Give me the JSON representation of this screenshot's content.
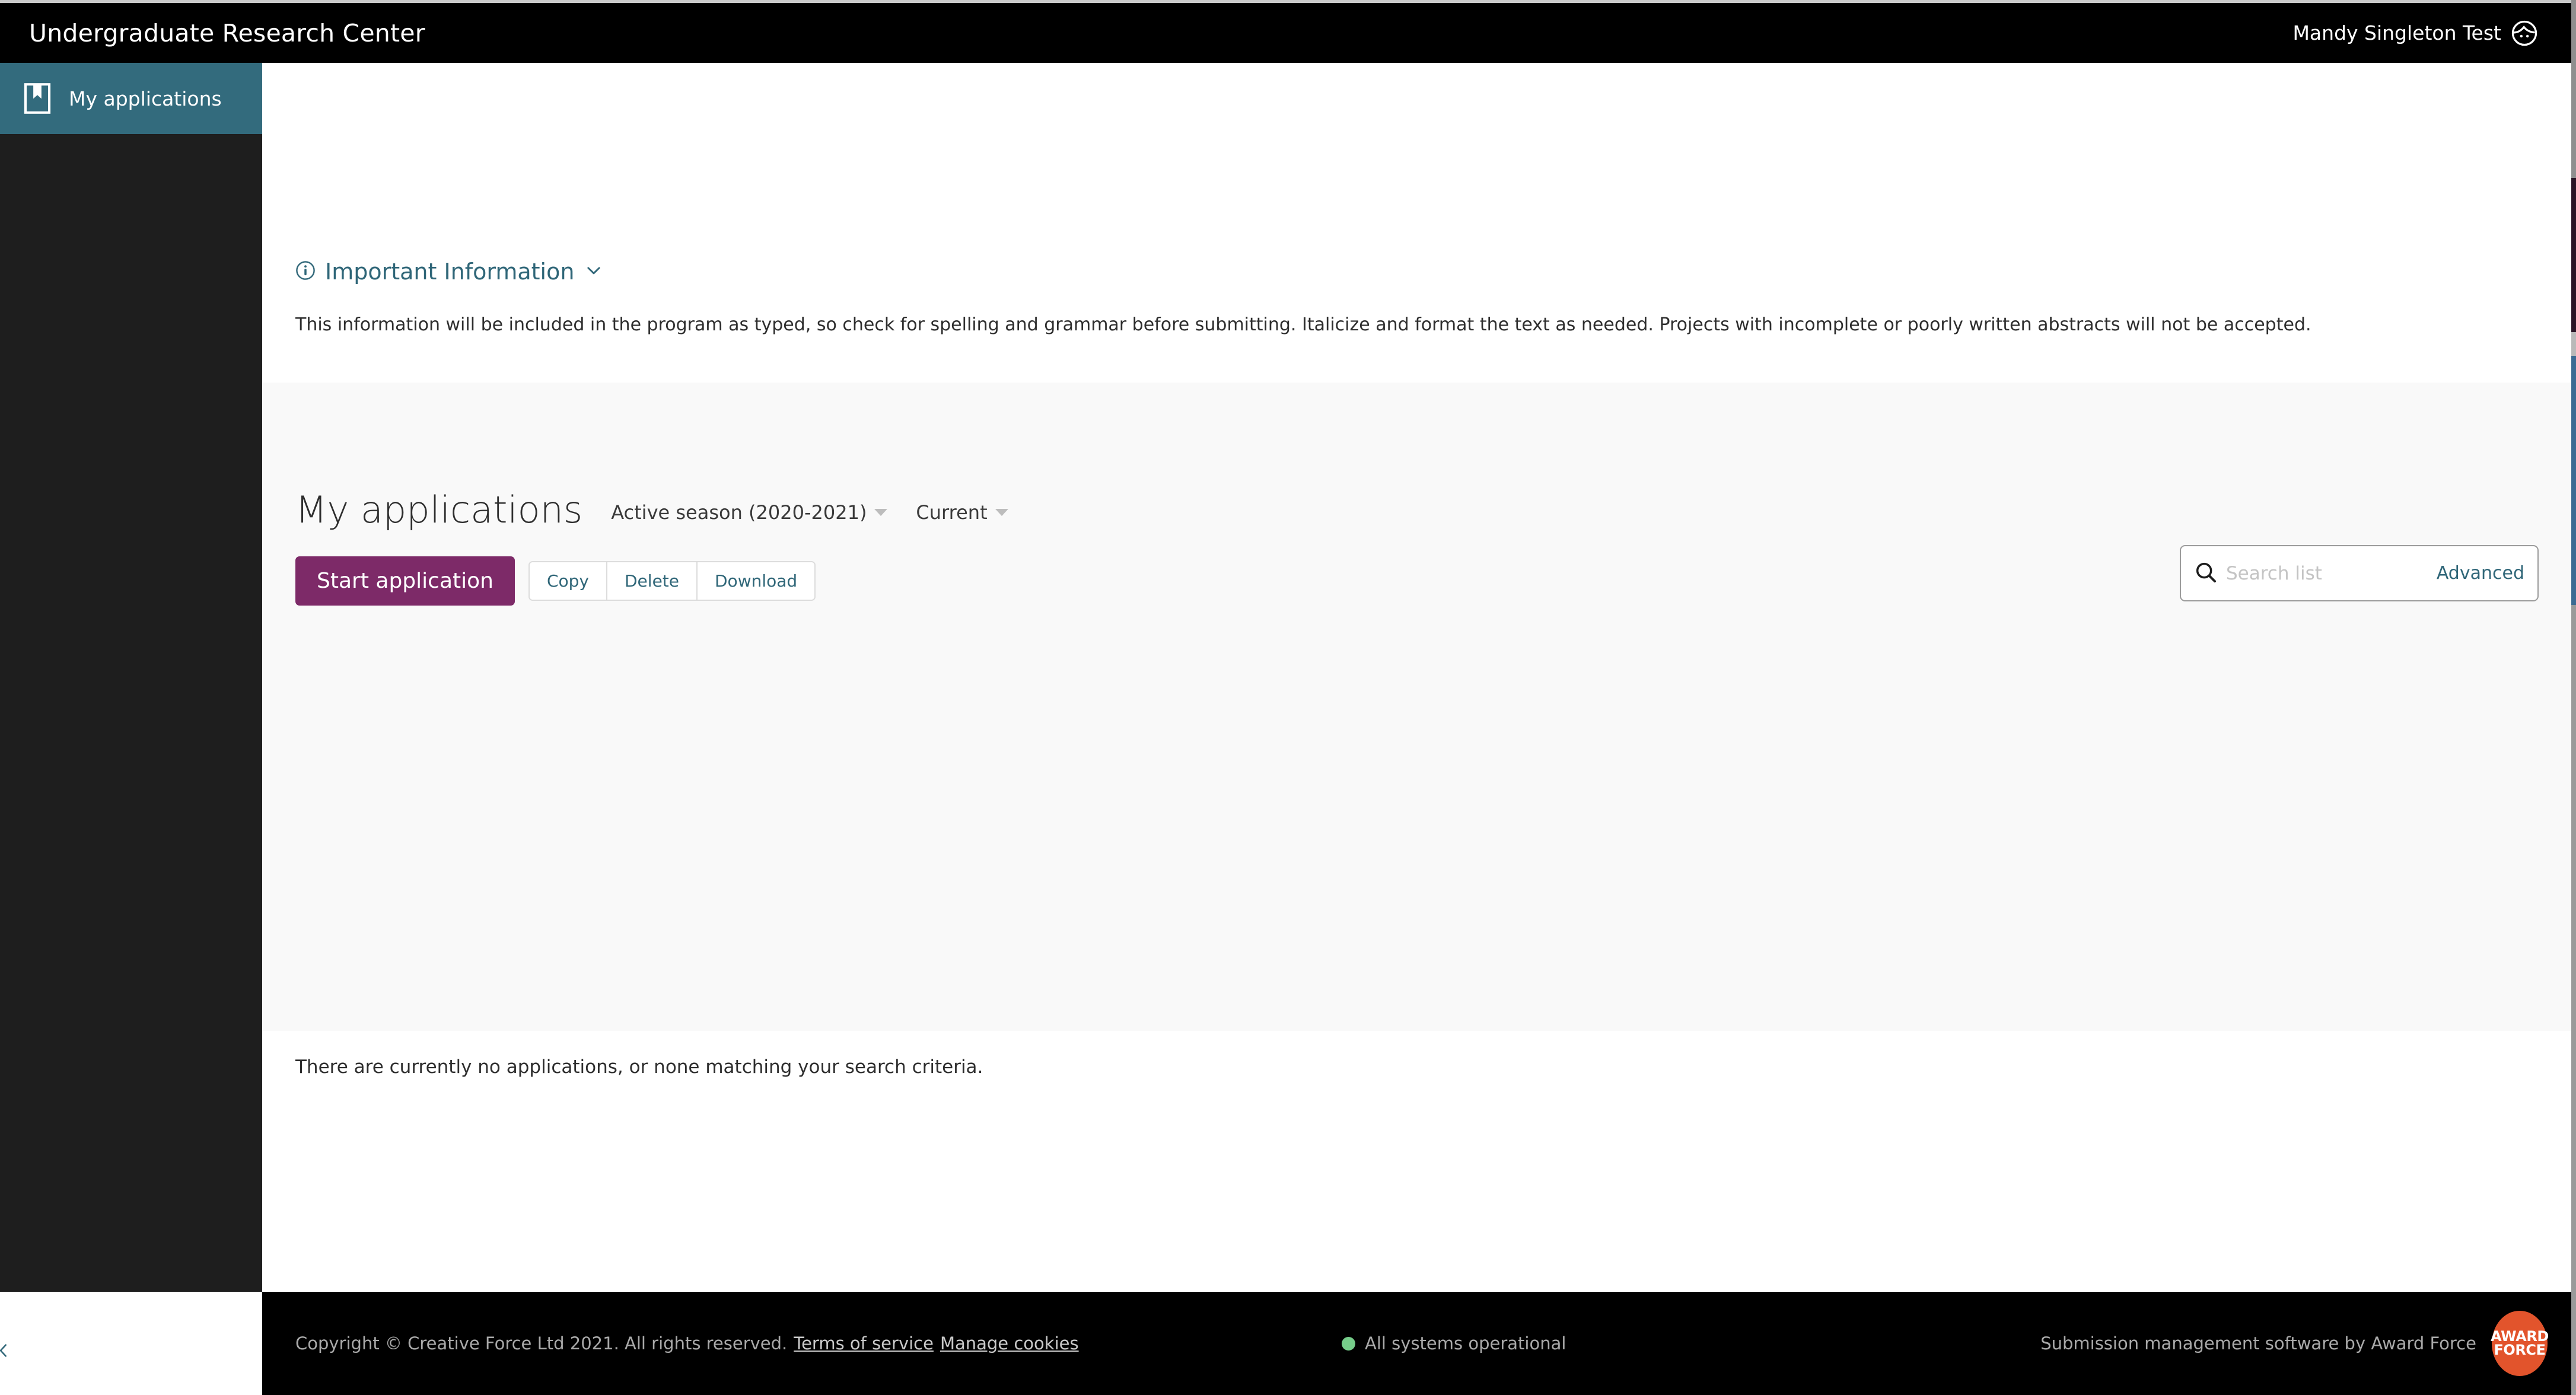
{
  "header": {
    "app_title": "Undergraduate Research Center",
    "user_name": "Mandy Singleton Test",
    "avatar_icon": "user-face-icon"
  },
  "sidebar": {
    "items": [
      {
        "label": "My applications",
        "icon": "bookmark-icon",
        "active": true
      }
    ]
  },
  "info_panel": {
    "icon": "info-circle-icon",
    "title": "Important Information",
    "toggle_icon": "chevron-down-icon",
    "body": "This information will be included in the program as typed, so check for spelling and grammar before submitting. Italicize and format the text as needed. Projects with incomplete or poorly written abstracts will not be accepted."
  },
  "applications": {
    "title": "My applications",
    "filters": [
      {
        "label": "Active season (2020-2021)",
        "icon": "caret-down-icon"
      },
      {
        "label": "Current",
        "icon": "caret-down-icon"
      }
    ],
    "primary_action": "Start application",
    "group_actions": [
      "Copy",
      "Delete",
      "Download"
    ],
    "search": {
      "icon": "search-icon",
      "placeholder": "Search list",
      "value": "",
      "advanced_label": "Advanced"
    },
    "empty_message": "There are currently no applications, or none matching your search criteria."
  },
  "footer": {
    "copyright": "Copyright © Creative Force Ltd 2021. All rights reserved.",
    "terms_link": "Terms of service",
    "cookies_link": "Manage cookies",
    "status_text": "All systems operational",
    "status_color": "#76cd8a",
    "brand_text": "Submission management software by Award Force",
    "brand_logo_line1": "AWARD",
    "brand_logo_line2": "FORCE",
    "collapse_icon": "chevron-left-icon"
  },
  "colors": {
    "header_bg": "#000000",
    "sidebar_bg": "#1e1e1e",
    "sidebar_active": "#336b7d",
    "accent_teal": "#2f6678",
    "primary_purple": "#7d2a68",
    "panel_bg": "#f9f9f9",
    "brand_orange": "#e2542c"
  }
}
